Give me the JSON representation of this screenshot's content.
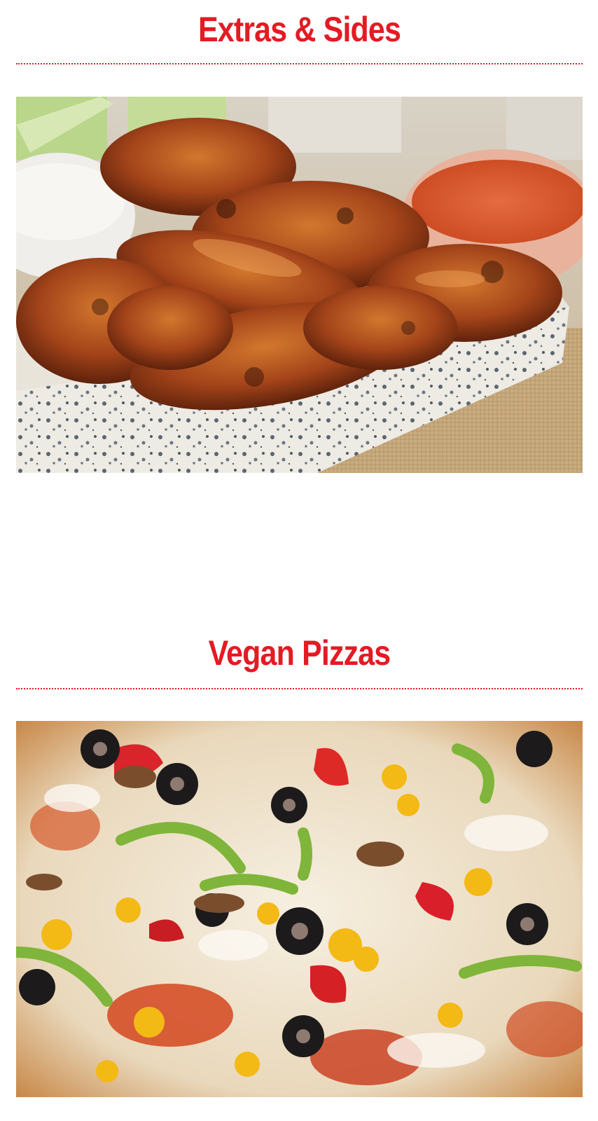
{
  "sections": [
    {
      "title": "Extras & Sides",
      "image": "chicken-wings-photo"
    },
    {
      "title": "Vegan Pizzas",
      "image": "vegan-pizza-photo"
    }
  ],
  "colors": {
    "accent": "#e31b23",
    "background": "#ffffff"
  }
}
